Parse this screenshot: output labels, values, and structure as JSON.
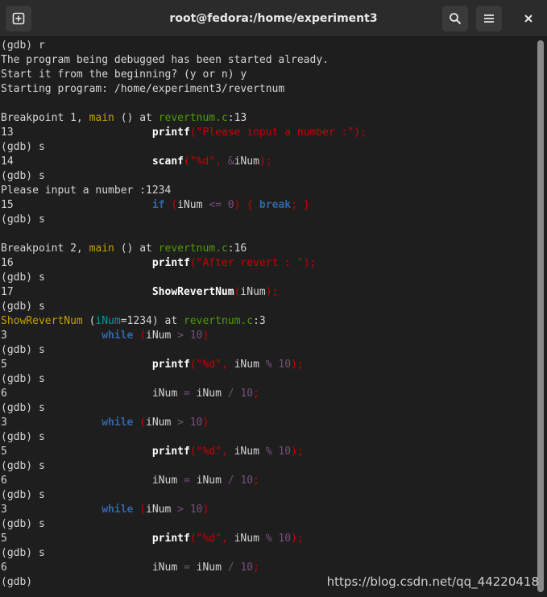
{
  "window": {
    "title": "root@fedora:/home/experiment3",
    "new_tab_icon": "new-tab-icon",
    "search_icon": "search-icon",
    "menu_icon": "hamburger-menu-icon",
    "close_icon": "close-icon"
  },
  "colors": {
    "default": "#d6d6d6",
    "bold": "#ffffff",
    "keyword": "#3465a4",
    "string": "#cc0000",
    "operator": "#75507b",
    "file": "#4e9a06",
    "function": "#c4a000",
    "param": "#06989a"
  },
  "terminal": {
    "lines": [
      [
        {
          "t": "(gdb) r"
        }
      ],
      [
        {
          "t": "The program being debugged has been started already."
        }
      ],
      [
        {
          "t": "Start it from the beginning? (y or n) y"
        }
      ],
      [
        {
          "t": "Starting program: /home/experiment3/revertnum"
        }
      ],
      [
        {
          "t": ""
        }
      ],
      [
        {
          "t": "Breakpoint 1, "
        },
        {
          "t": "main",
          "c": "function"
        },
        {
          "t": " () at "
        },
        {
          "t": "revertnum.c",
          "c": "file"
        },
        {
          "t": ":13"
        }
      ],
      [
        {
          "t": "13\t\t\t"
        },
        {
          "t": "printf",
          "c": "bold"
        },
        {
          "t": "(\"Please input a number :\");",
          "c": "string"
        }
      ],
      [
        {
          "t": "(gdb) s"
        }
      ],
      [
        {
          "t": "14\t\t\t"
        },
        {
          "t": "scanf",
          "c": "bold"
        },
        {
          "t": "(\"%d\", ",
          "c": "string"
        },
        {
          "t": "&",
          "c": "operator"
        },
        {
          "t": "iNum"
        },
        {
          "t": ");",
          "c": "string"
        }
      ],
      [
        {
          "t": "(gdb) s"
        }
      ],
      [
        {
          "t": "Please input a number :1234"
        }
      ],
      [
        {
          "t": "15\t\t\t"
        },
        {
          "t": "if",
          "c": "keyword"
        },
        {
          "t": " (",
          "c": "string"
        },
        {
          "t": "iNum"
        },
        {
          "t": " <= ",
          "c": "operator"
        },
        {
          "t": "0",
          "c": "operator"
        },
        {
          "t": ") { ",
          "c": "string"
        },
        {
          "t": "break",
          "c": "keyword"
        },
        {
          "t": "; }",
          "c": "string"
        }
      ],
      [
        {
          "t": "(gdb) s"
        }
      ],
      [
        {
          "t": ""
        }
      ],
      [
        {
          "t": "Breakpoint 2, "
        },
        {
          "t": "main",
          "c": "function"
        },
        {
          "t": " () at "
        },
        {
          "t": "revertnum.c",
          "c": "file"
        },
        {
          "t": ":16"
        }
      ],
      [
        {
          "t": "16\t\t\t"
        },
        {
          "t": "printf",
          "c": "bold"
        },
        {
          "t": "(\"After revert : \");",
          "c": "string"
        }
      ],
      [
        {
          "t": "(gdb) s"
        }
      ],
      [
        {
          "t": "17\t\t\t"
        },
        {
          "t": "ShowRevertNum",
          "c": "bold"
        },
        {
          "t": "(",
          "c": "string"
        },
        {
          "t": "iNum"
        },
        {
          "t": ");",
          "c": "string"
        }
      ],
      [
        {
          "t": "(gdb) s"
        }
      ],
      [
        {
          "t": "ShowRevertNum",
          "c": "function"
        },
        {
          "t": " ("
        },
        {
          "t": "iNum",
          "c": "param"
        },
        {
          "t": "=1234) at "
        },
        {
          "t": "revertnum.c",
          "c": "file"
        },
        {
          "t": ":3"
        }
      ],
      [
        {
          "t": "3\t\t"
        },
        {
          "t": "while",
          "c": "keyword"
        },
        {
          "t": " (",
          "c": "string"
        },
        {
          "t": "iNum"
        },
        {
          "t": " > ",
          "c": "operator"
        },
        {
          "t": "10",
          "c": "operator"
        },
        {
          "t": ")",
          "c": "string"
        }
      ],
      [
        {
          "t": "(gdb) s"
        }
      ],
      [
        {
          "t": "5\t\t\t"
        },
        {
          "t": "printf",
          "c": "bold"
        },
        {
          "t": "(\"%d\", ",
          "c": "string"
        },
        {
          "t": "iNum"
        },
        {
          "t": " % ",
          "c": "operator"
        },
        {
          "t": "10",
          "c": "operator"
        },
        {
          "t": ");",
          "c": "string"
        }
      ],
      [
        {
          "t": "(gdb) s"
        }
      ],
      [
        {
          "t": "6\t\t\t"
        },
        {
          "t": "iNum"
        },
        {
          "t": " = ",
          "c": "operator"
        },
        {
          "t": "iNum"
        },
        {
          "t": " / ",
          "c": "operator"
        },
        {
          "t": "10",
          "c": "operator"
        },
        {
          "t": ";",
          "c": "string"
        }
      ],
      [
        {
          "t": "(gdb) s"
        }
      ],
      [
        {
          "t": "3\t\t"
        },
        {
          "t": "while",
          "c": "keyword"
        },
        {
          "t": " (",
          "c": "string"
        },
        {
          "t": "iNum"
        },
        {
          "t": " > ",
          "c": "operator"
        },
        {
          "t": "10",
          "c": "operator"
        },
        {
          "t": ")",
          "c": "string"
        }
      ],
      [
        {
          "t": "(gdb) s"
        }
      ],
      [
        {
          "t": "5\t\t\t"
        },
        {
          "t": "printf",
          "c": "bold"
        },
        {
          "t": "(\"%d\", ",
          "c": "string"
        },
        {
          "t": "iNum"
        },
        {
          "t": " % ",
          "c": "operator"
        },
        {
          "t": "10",
          "c": "operator"
        },
        {
          "t": ");",
          "c": "string"
        }
      ],
      [
        {
          "t": "(gdb) s"
        }
      ],
      [
        {
          "t": "6\t\t\t"
        },
        {
          "t": "iNum"
        },
        {
          "t": " = ",
          "c": "operator"
        },
        {
          "t": "iNum"
        },
        {
          "t": " / ",
          "c": "operator"
        },
        {
          "t": "10",
          "c": "operator"
        },
        {
          "t": ";",
          "c": "string"
        }
      ],
      [
        {
          "t": "(gdb) s"
        }
      ],
      [
        {
          "t": "3\t\t"
        },
        {
          "t": "while",
          "c": "keyword"
        },
        {
          "t": " (",
          "c": "string"
        },
        {
          "t": "iNum"
        },
        {
          "t": " > ",
          "c": "operator"
        },
        {
          "t": "10",
          "c": "operator"
        },
        {
          "t": ")",
          "c": "string"
        }
      ],
      [
        {
          "t": "(gdb) s"
        }
      ],
      [
        {
          "t": "5\t\t\t"
        },
        {
          "t": "printf",
          "c": "bold"
        },
        {
          "t": "(\"%d\", ",
          "c": "string"
        },
        {
          "t": "iNum"
        },
        {
          "t": " % ",
          "c": "operator"
        },
        {
          "t": "10",
          "c": "operator"
        },
        {
          "t": ");",
          "c": "string"
        }
      ],
      [
        {
          "t": "(gdb) s"
        }
      ],
      [
        {
          "t": "6\t\t\t"
        },
        {
          "t": "iNum"
        },
        {
          "t": " = ",
          "c": "operator"
        },
        {
          "t": "iNum"
        },
        {
          "t": " / ",
          "c": "operator"
        },
        {
          "t": "10",
          "c": "operator"
        },
        {
          "t": ";",
          "c": "string"
        }
      ],
      [
        {
          "t": "(gdb) "
        }
      ]
    ]
  },
  "watermark": "https://blog.csdn.net/qq_44220418"
}
